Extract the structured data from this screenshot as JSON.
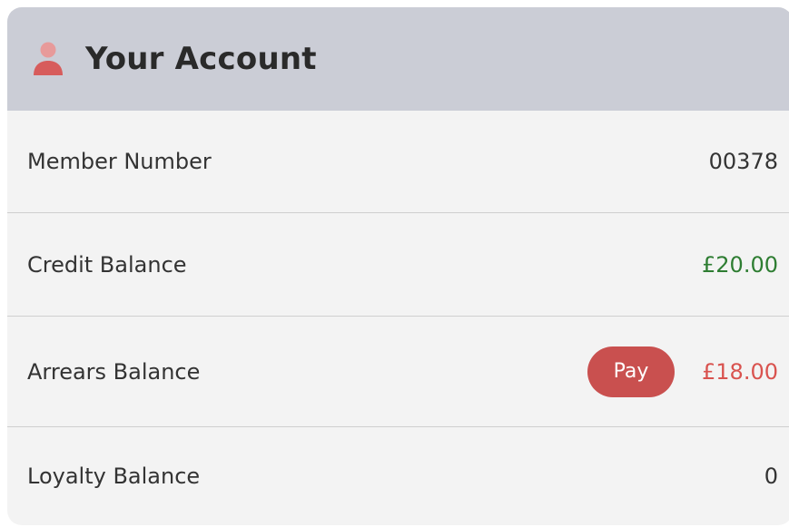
{
  "header": {
    "title": "Your Account",
    "icon": "user-icon",
    "icon_color": "#d75c5c",
    "background": "#cbcdd6"
  },
  "rows": [
    {
      "label": "Member Number",
      "value": "00378",
      "value_color": "#333333"
    },
    {
      "label": "Credit Balance",
      "value": "£20.00",
      "value_color": "#2e7d32"
    },
    {
      "label": "Arrears Balance",
      "value": "£18.00",
      "value_color": "#d9534f",
      "button_label": "Pay",
      "button_color": "#c9504f"
    },
    {
      "label": "Loyalty Balance",
      "value": "0",
      "value_color": "#333333"
    }
  ]
}
